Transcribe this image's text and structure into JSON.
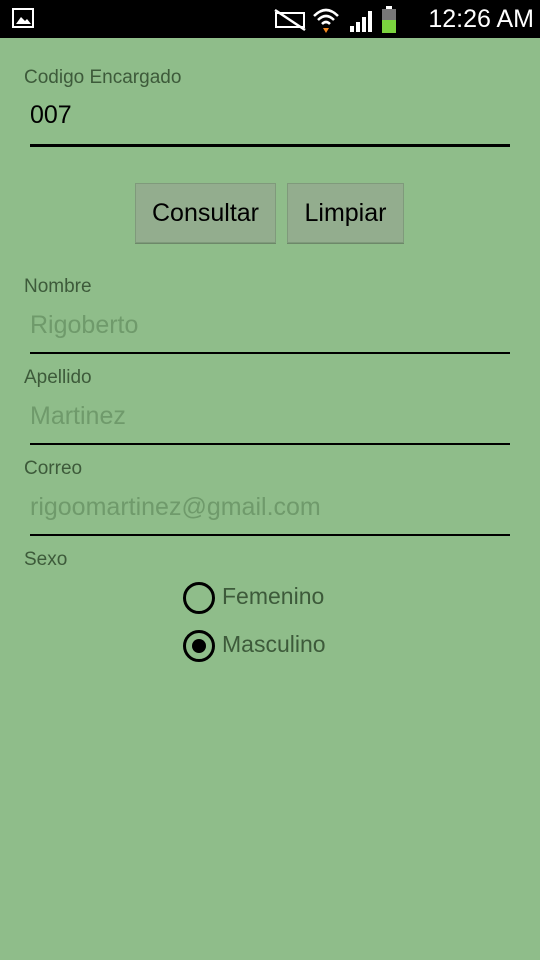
{
  "status_bar": {
    "time": "12:26 AM",
    "left_icon": "image-icon",
    "icons": [
      "mute-icon",
      "wifi-icon",
      "signal-icon",
      "battery-icon"
    ]
  },
  "form": {
    "codigo": {
      "label": "Codigo Encargado",
      "value": "007"
    },
    "buttons": {
      "consultar": "Consultar",
      "limpiar": "Limpiar"
    },
    "nombre": {
      "label": "Nombre",
      "placeholder": "Rigoberto"
    },
    "apellido": {
      "label": "Apellido",
      "placeholder": "Martinez"
    },
    "correo": {
      "label": "Correo",
      "placeholder": "rigoomartinez@gmail.com"
    },
    "sexo": {
      "label": "Sexo",
      "options": [
        {
          "label": "Femenino",
          "selected": false
        },
        {
          "label": "Masculino",
          "selected": true
        }
      ]
    }
  },
  "colors": {
    "background": "#8fbd8a",
    "button": "#93ad8e",
    "label": "#3d5a3a",
    "placeholder": "#6f9a6b"
  }
}
